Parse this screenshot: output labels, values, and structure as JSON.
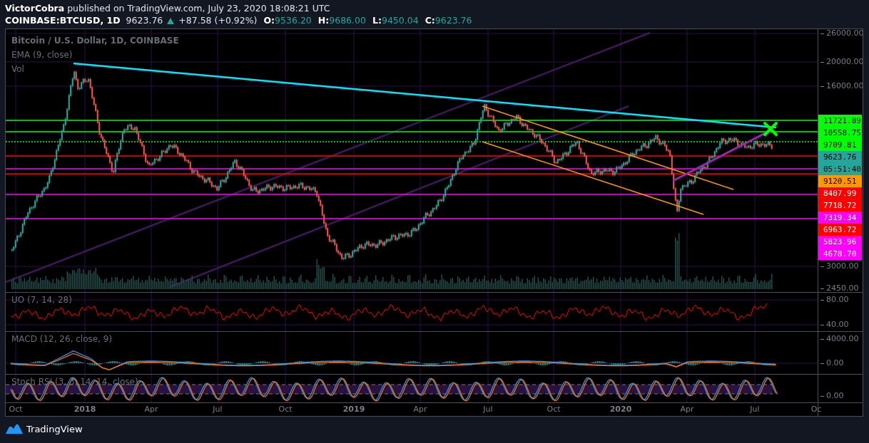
{
  "header": {
    "byline": "**VictorCobra** published on TradingView.com, July 23, 2020 18:08:21 UTC",
    "symbol": "COINBASE:BTCUSD, 1D",
    "last": "9623.76",
    "change": "+87.58 (+0.92%)",
    "ohlc": [
      {
        "label": "O:",
        "value": "9536.20"
      },
      {
        "label": "H:",
        "value": "9686.00"
      },
      {
        "label": "L:",
        "value": "9450.04"
      },
      {
        "label": "C:",
        "value": "9623.76"
      }
    ]
  },
  "chart": {
    "legend": [
      {
        "text": "Bitcoin / U.S. Dollar, 1D, COINBASE",
        "kind": "title"
      },
      {
        "text": "EMA (9, close)",
        "kind": "study"
      },
      {
        "text": "Vol",
        "kind": "study"
      }
    ],
    "price_axis": {
      "ticks": [
        "26000.00",
        "20000.00",
        "16000.00",
        "3000.00",
        "2450.00"
      ],
      "price_labels": [
        {
          "text": "11721.89",
          "color": "#00ff00"
        },
        {
          "text": "10558.75",
          "color": "#00ff00"
        },
        {
          "text": "9709.81",
          "color": "#00ff00"
        },
        {
          "text": "9623.76",
          "color": "#26a69a"
        },
        {
          "text": "05:51:40",
          "color": "#26a69a"
        },
        {
          "text": "9120.51",
          "color": "#ff9800"
        },
        {
          "text": "8407.99",
          "color": "#ff0000"
        },
        {
          "text": "7718.72",
          "color": "#ff0000"
        },
        {
          "text": "7319.34",
          "color": "#ff00ff"
        },
        {
          "text": "6963.72",
          "color": "#ff0000"
        },
        {
          "text": "5823.96",
          "color": "#ff00ff"
        },
        {
          "text": "4678.70",
          "color": "#ff00ff"
        }
      ]
    },
    "panes": [
      {
        "kind": "uo",
        "title": "UO (7, 14, 28)",
        "ticks": [
          "80.00",
          "40.00"
        ]
      },
      {
        "kind": "macd",
        "title": "MACD (12, 26, close, 9)",
        "ticks": [
          "4000.00",
          "0.00"
        ]
      },
      {
        "kind": "stoch",
        "title": "Stoch RSI (3, 3, 14, 14, close)",
        "ticks": [
          "0.00"
        ]
      }
    ],
    "time_axis": [
      {
        "text": "Oct",
        "kind": "month"
      },
      {
        "text": "2018",
        "kind": "year"
      },
      {
        "text": "Apr",
        "kind": "month"
      },
      {
        "text": "Jul",
        "kind": "month"
      },
      {
        "text": "Oct",
        "kind": "month"
      },
      {
        "text": "2019",
        "kind": "year"
      },
      {
        "text": "Apr",
        "kind": "month"
      },
      {
        "text": "Jul",
        "kind": "month"
      },
      {
        "text": "Oct",
        "kind": "month"
      },
      {
        "text": "2020",
        "kind": "year"
      },
      {
        "text": "Apr",
        "kind": "month"
      },
      {
        "text": "Jul",
        "kind": "month"
      },
      {
        "text": "Oc",
        "kind": "month"
      }
    ]
  },
  "footer": {
    "brand": "TradingView"
  }
}
